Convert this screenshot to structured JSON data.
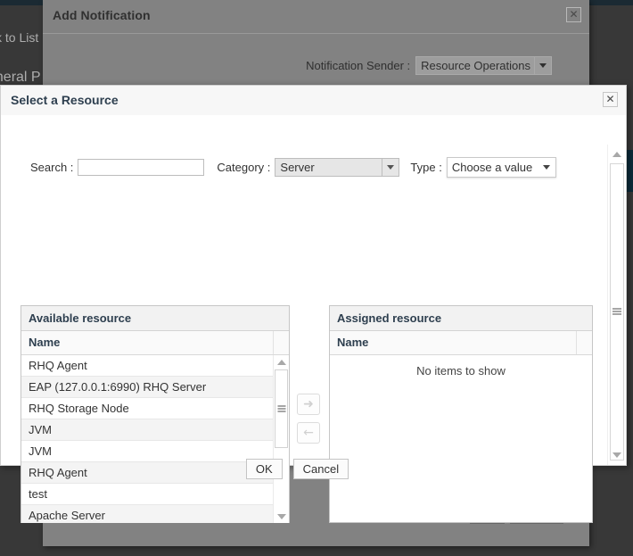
{
  "background": {
    "back_to_list": "ck to List",
    "general_properties": "eneral P",
    "accent_color": "#0b2b3a",
    "page_bg": "#383838"
  },
  "add_notification_dialog": {
    "title": "Add Notification",
    "close_icon": "close-icon",
    "close_glyph": "✕",
    "sender_label": "Notification Sender :",
    "sender_value": "Resource Operations",
    "sender_arrow_icon": "chevron-down-icon",
    "ok_label": "OK",
    "cancel_label": "Cancel"
  },
  "select_resource_dialog": {
    "title": "Select a Resource",
    "close_icon": "close-icon",
    "close_glyph": "✕",
    "filters": {
      "search_label": "Search :",
      "search_value": "",
      "search_placeholder": "",
      "category_label": "Category :",
      "category_value": "Server",
      "type_label": "Type :",
      "type_value": "Choose a value"
    },
    "available": {
      "panel_title": "Available resource",
      "column_header": "Name",
      "rows": [
        "RHQ Agent",
        "EAP (127.0.0.1:6990) RHQ Server",
        "RHQ Storage Node",
        "JVM",
        "JVM",
        "RHQ Agent",
        "test",
        "Apache Server"
      ]
    },
    "assigned": {
      "panel_title": "Assigned resource",
      "column_header": "Name",
      "empty_text": "No items to show",
      "rows": []
    },
    "transfer": {
      "add_icon": "arrow-right-icon",
      "add_glyph": "➜",
      "remove_icon": "arrow-left-icon",
      "remove_glyph": "←"
    },
    "ok_label": "OK",
    "cancel_label": "Cancel",
    "scrollbar": {
      "up_icon": "triangle-up-icon",
      "down_icon": "triangle-down-icon",
      "grip_icon": "grip-icon"
    }
  }
}
